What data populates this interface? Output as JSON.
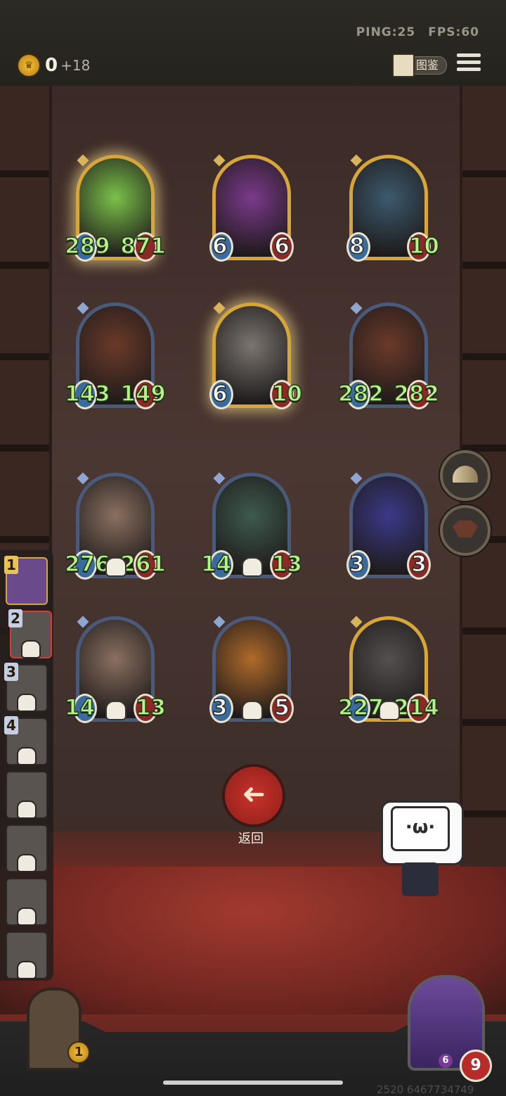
{
  "header": {
    "ping": "PING:25",
    "fps": "FPS:60",
    "coins": "0",
    "coins_income": "+18",
    "codex_label": "图鉴"
  },
  "board": {
    "cards": [
      {
        "name": "green-dragon-card",
        "attack": "289",
        "health": "871",
        "frame": "gold",
        "glow": true,
        "art_color": "#7cc24a"
      },
      {
        "name": "red-dragon-card",
        "attack": "6",
        "health": "6",
        "frame": "gold",
        "glow": false,
        "art_color": "#7b3a8c"
      },
      {
        "name": "two-headed-dragon-card",
        "attack": "8",
        "health": "10",
        "frame": "gold",
        "glow": false,
        "art_color": "#3c5a6e"
      },
      {
        "name": "serpent-dragon-card",
        "attack": "143",
        "health": "149",
        "frame": "blue",
        "glow": false,
        "art_color": "#6b3a2a"
      },
      {
        "name": "grey-dragon-card",
        "attack": "6",
        "health": "10",
        "frame": "gold",
        "glow": true,
        "art_color": "#7a7570"
      },
      {
        "name": "serpent-dragon-card-2",
        "attack": "282",
        "health": "282",
        "frame": "blue",
        "glow": false,
        "art_color": "#6b3a2a"
      },
      {
        "name": "skull-crab-card",
        "attack": "276",
        "health": "261",
        "frame": "blue",
        "glow": false,
        "art_color": "#8a7060"
      },
      {
        "name": "iron-knight-card",
        "attack": "14",
        "health": "13",
        "frame": "blue",
        "glow": false,
        "art_color": "#3e5a4e"
      },
      {
        "name": "blue-dragon-card",
        "attack": "3",
        "health": "3",
        "frame": "blue",
        "glow": false,
        "art_color": "#3a3a8a"
      },
      {
        "name": "skull-crab-card-2",
        "attack": "14",
        "health": "13",
        "frame": "blue",
        "glow": false,
        "art_color": "#8a7060"
      },
      {
        "name": "tiger-dragon-card",
        "attack": "3",
        "health": "5",
        "frame": "blue",
        "glow": false,
        "art_color": "#b06a2a"
      },
      {
        "name": "mech-cannon-card",
        "attack": "227",
        "health": "214",
        "frame": "gold",
        "glow": false,
        "art_color": "#555050"
      }
    ]
  },
  "side_list": {
    "items": [
      {
        "num": "1",
        "state": "current"
      },
      {
        "num": "2",
        "state": "active"
      },
      {
        "num": "3",
        "state": "normal"
      },
      {
        "num": "4",
        "state": "normal"
      },
      {
        "num": "",
        "state": "normal"
      },
      {
        "num": "",
        "state": "normal"
      },
      {
        "num": "",
        "state": "normal"
      },
      {
        "num": "",
        "state": "normal"
      }
    ]
  },
  "actions": {
    "back_arrow": "➜",
    "back_label": "返回"
  },
  "mascot": {
    "face": "·ω·"
  },
  "chest": {
    "count": "1"
  },
  "hero": {
    "health": "9",
    "tier": "6"
  },
  "footer": {
    "uid": "2520 6467734749"
  }
}
